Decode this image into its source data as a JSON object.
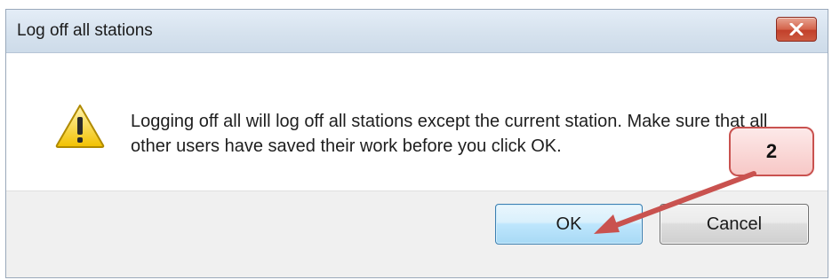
{
  "window": {
    "title": "Log off all stations",
    "close_icon": "close-icon"
  },
  "message": {
    "icon": "warning-icon",
    "text": "Logging off all will log off all stations except the current station. Make sure that all other users have saved their work before you click OK."
  },
  "buttons": {
    "ok_label": "OK",
    "cancel_label": "Cancel"
  },
  "annotation": {
    "step_number": "2",
    "color": "#c9524f"
  },
  "colors": {
    "titlebar": "#d6e2ee",
    "close_button": "#c2402b",
    "footer": "#f0f0f0",
    "ok_border": "#3c7fb1"
  }
}
